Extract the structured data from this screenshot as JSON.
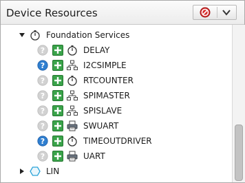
{
  "panel": {
    "title": "Device Resources"
  },
  "tree": {
    "group": {
      "label": "Foundation Services",
      "expanded": true,
      "icon": "stopwatch-icon"
    },
    "items": [
      {
        "label": "DELAY",
        "help": "inactive",
        "type_icon": "stopwatch-icon"
      },
      {
        "label": "I2CSIMPLE",
        "help": "active",
        "type_icon": "network-tree-icon"
      },
      {
        "label": "RTCOUNTER",
        "help": "inactive",
        "type_icon": "stopwatch-icon"
      },
      {
        "label": "SPIMASTER",
        "help": "inactive",
        "type_icon": "network-tree-icon"
      },
      {
        "label": "SPISLAVE",
        "help": "inactive",
        "type_icon": "network-tree-icon"
      },
      {
        "label": "SWUART",
        "help": "inactive",
        "type_icon": "printer-icon"
      },
      {
        "label": "TIMEOUTDRIVER",
        "help": "active",
        "type_icon": "stopwatch-icon"
      },
      {
        "label": "UART",
        "help": "inactive",
        "type_icon": "printer-icon"
      }
    ],
    "collapsed_group": {
      "label": "LIN",
      "expanded": false,
      "icon": "hexagon-icon"
    }
  },
  "colors": {
    "help_active": "#2f7fd0",
    "help_inactive": "#c9c9c9",
    "add_green": "#3aa34a",
    "stop_red": "#d62b2b",
    "hexagon_blue": "#2aa3d8"
  }
}
